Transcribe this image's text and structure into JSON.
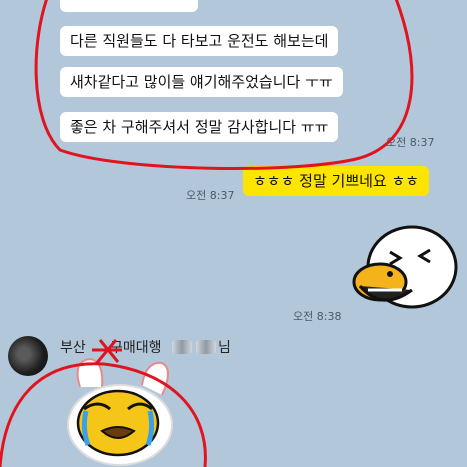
{
  "messages_in": [
    {
      "text": "다른 직원들도 다 타보고 운전도 해보는데"
    },
    {
      "text": "새차같다고 많이들 얘기해주었습니다 ㅜㅠ"
    },
    {
      "text": "좋은 차 구해주셔서 정말 감사합니다 ㅠㅠ"
    }
  ],
  "time_in_1": "오전 8:37",
  "message_out": {
    "text": "ㅎㅎㅎ 정말 기쁘네요 ㅎㅎ",
    "time": "오전 8:37"
  },
  "emoticon_time": "오전 8:38",
  "sender": {
    "name_part1": "부산",
    "name_part2": "구매대행",
    "name_suffix": "님"
  },
  "colors": {
    "background": "#b2c7d9",
    "bubble_in": "#ffffff",
    "bubble_out": "#fee500",
    "annotation": "#e0141e"
  }
}
